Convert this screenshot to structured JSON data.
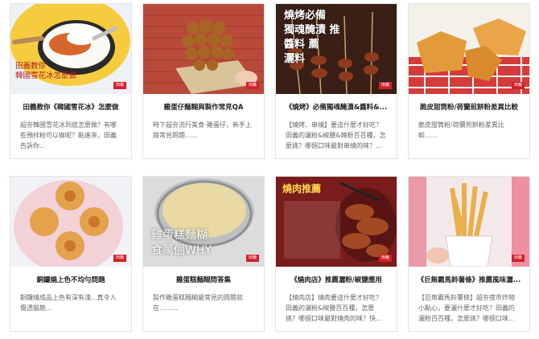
{
  "cards": [
    {
      "title": "田義教你《韓國雪花冰》怎麼做",
      "excerpt": "超夯韓國雪花冰到底怎麼做？有哪些預拌粉可以做呢？點進來，田義告訴你...",
      "overlay": "田義教你\n韓國雪花冰怎麼做",
      "tag": "田義",
      "icon": "shaved-ice-image"
    },
    {
      "title": "雞蛋仔麵糊與製作常見QA",
      "excerpt": "時下超夯流行美食-雞蛋仔，新手上路常見問題......",
      "overlay": "",
      "tag": "田義",
      "icon": "egg-waffle-image"
    },
    {
      "title": "《燒烤》必備獨魂醃漬&醬料&...",
      "excerpt": "【燒烤、串燒】要這什麼才好吃？田義的灑粉&椒鹽&辣粉百百種，怎麼挑？哪個口味最對串燒的味？...",
      "overlay": "燒烤必備\n獨魂醃漬 推\n醬料 薦\n灑料",
      "tag": "田義",
      "icon": "skewers-image"
    },
    {
      "title": "脆皮甜筒粉/荷蘭煎餅粉差異比較",
      "excerpt": "脆皮甜筒粉/荷蘭煎餅粉差異比較......",
      "overlay": "",
      "tag": "田義",
      "icon": "waffle-cone-image"
    },
    {
      "title": "銅鑼燒上色不均勻問題",
      "excerpt": "銅鑼燒成品上色有深有淺...真令人傷透腦筋...",
      "overlay": "",
      "tag": "田義",
      "icon": "dorayaki-image"
    },
    {
      "title": "雞蛋糕麵糊問答集",
      "excerpt": "製作雞蛋糕麵糊最常見的問題就在.........",
      "overlay": "雞蛋糕麵糊\n食萬個WHY",
      "tag": "田義",
      "icon": "batter-bowl-image"
    },
    {
      "title": "《燒肉店》推薦灑粉/椒鹽應用",
      "excerpt": "【燒肉店】燒肉要這什麼才好吃？田義的灑粉&椒鹽百百種，怎麼挑？哪個口味最對燒肉的味？快...",
      "overlay": "燒肉推薦",
      "tag": "田義",
      "icon": "grilled-meat-image"
    },
    {
      "title": "《巨無霸馬鈴薯條》推薦風味灑...",
      "excerpt": "【巨無霸馬鈴薯條】超夯夜市炸物小點心，要灑什麼才好吃？田義的灑粉百百種，怎麼挑？哪個口味...",
      "overlay": "",
      "tag": "田義",
      "icon": "fries-cup-image"
    }
  ],
  "colors": {
    "brand_red": "#d3202a",
    "text_dark": "#222222",
    "text_muted": "#666666"
  }
}
